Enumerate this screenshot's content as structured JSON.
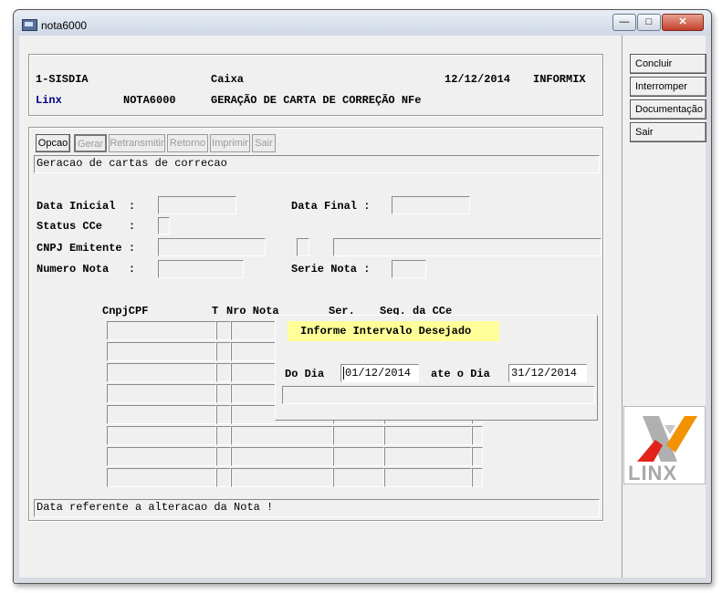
{
  "window": {
    "title": "nota6000"
  },
  "header": {
    "system": "1-SISDIA",
    "module": "Caixa",
    "date": "12/12/2014",
    "db": "INFORMIX",
    "company": "Linx",
    "program": "NOTA6000",
    "description": "GERAÇÃO DE CARTA DE CORREÇÃO NFe"
  },
  "menu": {
    "items": [
      "Opcao",
      "Gerar",
      "Retransmitir",
      "Retorno",
      "Imprimir",
      "Sair"
    ],
    "message": "Geracao de cartas de correcao"
  },
  "form": {
    "data_inicial_label": "Data Inicial  :",
    "data_final_label": "Data Final :",
    "status_label": "Status CCe    :",
    "cnpj_label": "CNPJ Emitente :",
    "numero_label": "Numero Nota   :",
    "serie_label": "Serie Nota :"
  },
  "table": {
    "headers": {
      "cnpj": "CnpjCPF",
      "t": "T",
      "nro": "Nro Nota",
      "ser": "Ser.",
      "seq": "Seq. da CCe"
    }
  },
  "dialog": {
    "title": "Informe Intervalo Desejado",
    "do_dia_label": "Do Dia",
    "do_dia_value": "01/12/2014",
    "ate_label": "ate o Dia",
    "ate_value": "31/12/2014"
  },
  "status_bar": {
    "message": "Data referente a alteracao da Nota !"
  },
  "side_buttons": [
    "Concluir",
    "Interromper",
    "Documentação",
    "Sair"
  ],
  "logo": {
    "text": "LINX"
  },
  "colors": {
    "highlight": "#ffff99",
    "accent_blue": "#000080",
    "logo_orange": "#f39200"
  }
}
